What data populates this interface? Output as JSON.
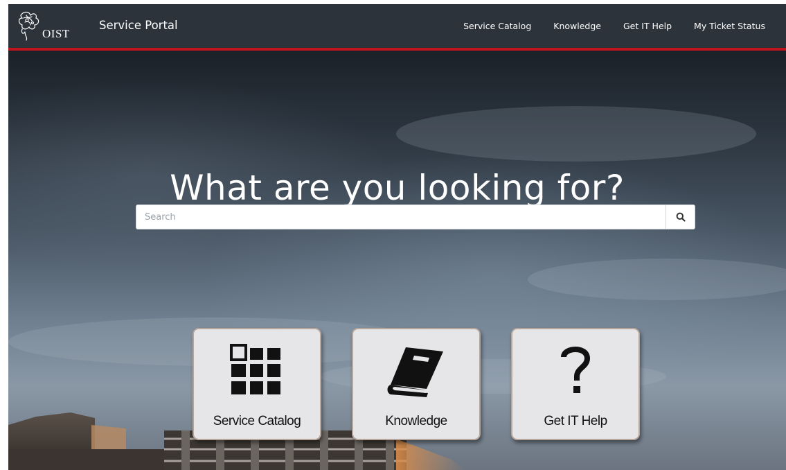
{
  "header": {
    "logo_text": "OIST",
    "title": "Service Portal",
    "nav": [
      {
        "label": "Service Catalog"
      },
      {
        "label": "Knowledge"
      },
      {
        "label": "Get IT Help"
      },
      {
        "label": "My Ticket Status"
      }
    ],
    "accent_color": "#c0151f",
    "background_color": "#2c333b"
  },
  "hero": {
    "title": "What are you looking for?",
    "search": {
      "placeholder": "Search",
      "value": "",
      "icon": "search-icon"
    }
  },
  "tiles": [
    {
      "label": "Service Catalog",
      "icon": "grid-icon"
    },
    {
      "label": "Knowledge",
      "icon": "book-icon"
    },
    {
      "label": "Get IT Help",
      "icon": "question-mark-icon"
    }
  ]
}
